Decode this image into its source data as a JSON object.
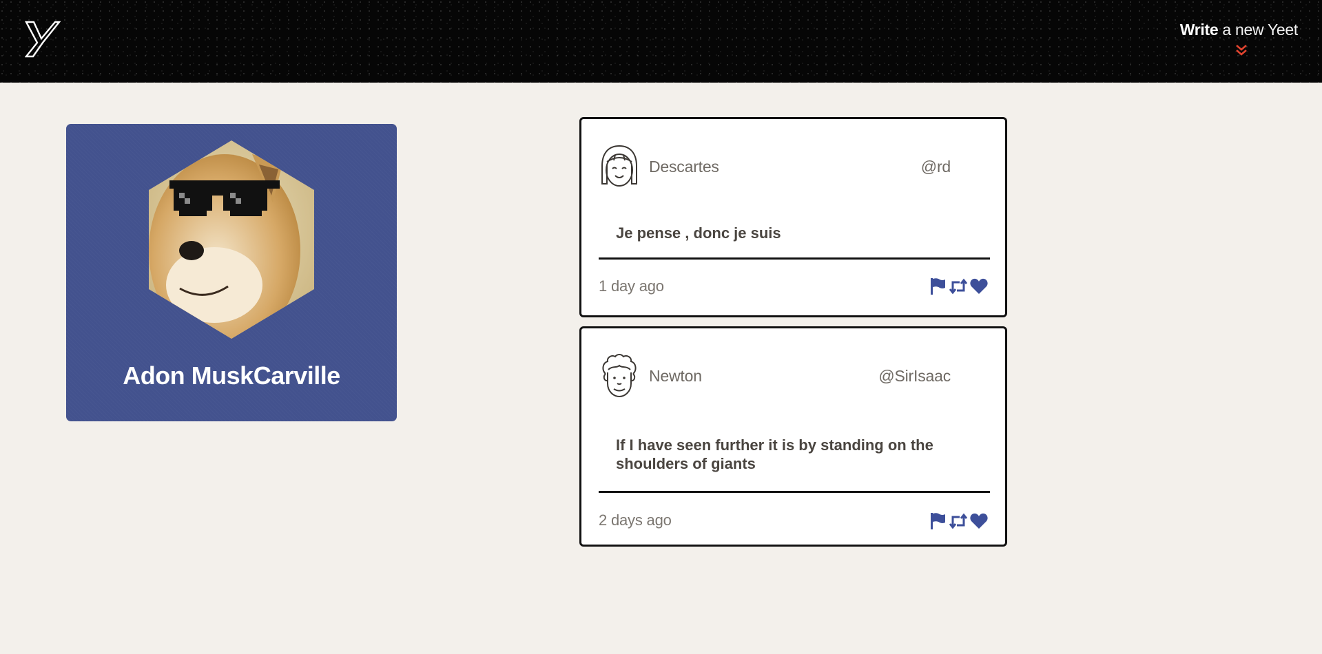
{
  "header": {
    "logo_icon": "y-logo-icon",
    "write_strong": "Write",
    "write_rest": " a new Yeet",
    "chevron_icon": "double-chevron-down-icon",
    "chevron_color": "#e2442f"
  },
  "profile": {
    "name": "Adon MuskCarville",
    "avatar": "doge-with-pixel-sunglasses",
    "card_color": "#43528e"
  },
  "posts": [
    {
      "author": "Descartes",
      "handle": "@rd",
      "text": "Je pense , donc je suis",
      "time": "1 day ago",
      "avatar_icon": "girl-avatar-icon"
    },
    {
      "author": "Newton",
      "handle": "@SirIsaac",
      "text": "If I have seen further it is by standing on the shoulders of giants",
      "time": "2 days ago",
      "avatar_icon": "curly-hair-avatar-icon"
    }
  ],
  "actions": {
    "flag_icon": "flag-icon",
    "repost_icon": "repost-icon",
    "like_icon": "heart-icon",
    "icon_color": "#3d4f9a"
  }
}
